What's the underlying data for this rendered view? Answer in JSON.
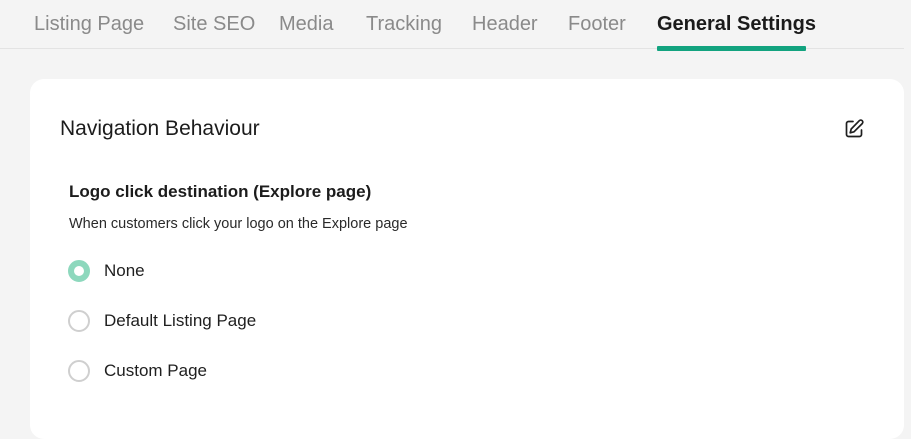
{
  "tabs": [
    {
      "label": "Listing Page"
    },
    {
      "label": "Site SEO"
    },
    {
      "label": "Media"
    },
    {
      "label": "Tracking"
    },
    {
      "label": "Header"
    },
    {
      "label": "Footer"
    },
    {
      "label": "General Settings",
      "active": true
    }
  ],
  "colors": {
    "accent": "#12a37f",
    "radio_selected": "#8dd8bd",
    "tab_inactive": "#8a8a8a",
    "page_background": "#f4f4f4"
  },
  "card": {
    "title": "Navigation Behaviour",
    "edit_icon": "edit-icon",
    "section": {
      "label": "Logo click destination (Explore page)",
      "description": "When customers click your logo on the Explore page",
      "options": [
        {
          "label": "None",
          "selected": true
        },
        {
          "label": "Default Listing Page",
          "selected": false
        },
        {
          "label": "Custom Page",
          "selected": false
        }
      ]
    }
  }
}
